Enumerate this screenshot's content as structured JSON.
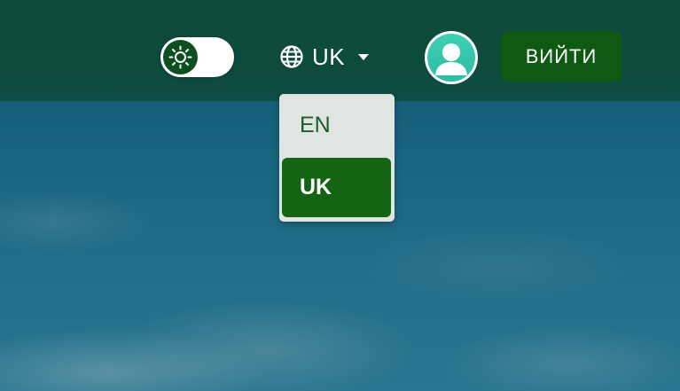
{
  "header": {
    "theme_toggle": {
      "icon": "sun-icon",
      "state": "light"
    },
    "language": {
      "current": "UK",
      "icon": "globe-icon",
      "caret_icon": "caret-down-icon"
    },
    "avatar": {
      "icon": "user-icon"
    },
    "logout_label": "ВИЙТИ"
  },
  "language_menu": {
    "options": [
      {
        "label": "EN",
        "selected": false
      },
      {
        "label": "UK",
        "selected": true
      }
    ]
  },
  "colors": {
    "header_bg": "#0d4b3d",
    "accent_green": "#0e5a12",
    "selected_option": "#156414",
    "menu_bg": "#e1e5e1",
    "avatar_teal": "#2bbca4"
  }
}
